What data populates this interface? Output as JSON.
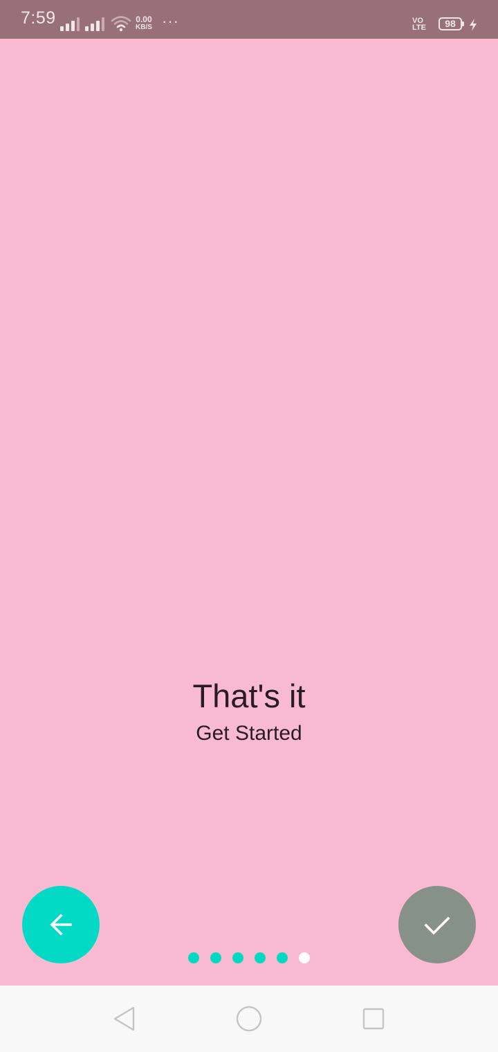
{
  "status_bar": {
    "time": "7:59",
    "net_speed_value": "0.00",
    "net_speed_unit": "KB/S",
    "more": "···",
    "volte_top": "VO",
    "volte_bottom": "LTE",
    "battery_level": "98",
    "icons": [
      "signal-icon",
      "signal-icon",
      "wifi-icon",
      "more-icon",
      "volte-icon",
      "battery-icon",
      "charging-icon"
    ]
  },
  "slide": {
    "title": "That's it",
    "subtitle": "Get Started",
    "background_color": "#f8bad0"
  },
  "buttons": {
    "back_icon": "arrow-left-icon",
    "back_color": "#03dac6",
    "done_icon": "checkmark-icon",
    "done_color": "#86918a"
  },
  "pager": {
    "total_pages": 6,
    "current_page": 6
  },
  "nav_bar": {
    "icons": [
      "back-triangle-icon",
      "home-circle-icon",
      "recents-square-icon"
    ]
  }
}
